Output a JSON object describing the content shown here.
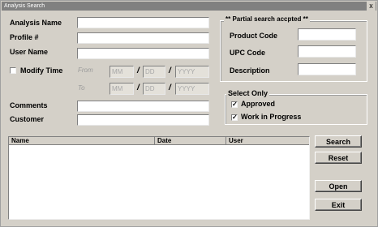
{
  "window": {
    "title": "Analysis Search",
    "close_glyph": "x"
  },
  "form": {
    "analysis_name_label": "Analysis Name",
    "profile_label": "Profile #",
    "user_name_label": "User Name",
    "modify_time_label": "Modify Time",
    "modify_time_checked": false,
    "from_label": "From",
    "to_label": "To",
    "date_placeholders": {
      "month": "MM",
      "day": "DD",
      "year": "YYYY"
    },
    "date_separator": "/",
    "comments_label": "Comments",
    "customer_label": "Customer",
    "analysis_name_value": "",
    "profile_value": "",
    "user_name_value": "",
    "comments_value": "",
    "customer_value": ""
  },
  "partial_search": {
    "title": "** Partial search accpted **",
    "product_code_label": "Product Code",
    "upc_code_label": "UPC Code",
    "description_label": "Description",
    "product_code_value": "",
    "upc_code_value": "",
    "description_value": ""
  },
  "select_only": {
    "title": "Select Only",
    "approved_label": "Approved",
    "approved_checked": true,
    "wip_label": "Work in Progress",
    "wip_checked": true,
    "check_glyph": "✓"
  },
  "results": {
    "columns": [
      "Name",
      "Date",
      "User"
    ],
    "rows": []
  },
  "buttons": {
    "search": "Search",
    "reset": "Reset",
    "open": "Open",
    "exit": "Exit"
  }
}
